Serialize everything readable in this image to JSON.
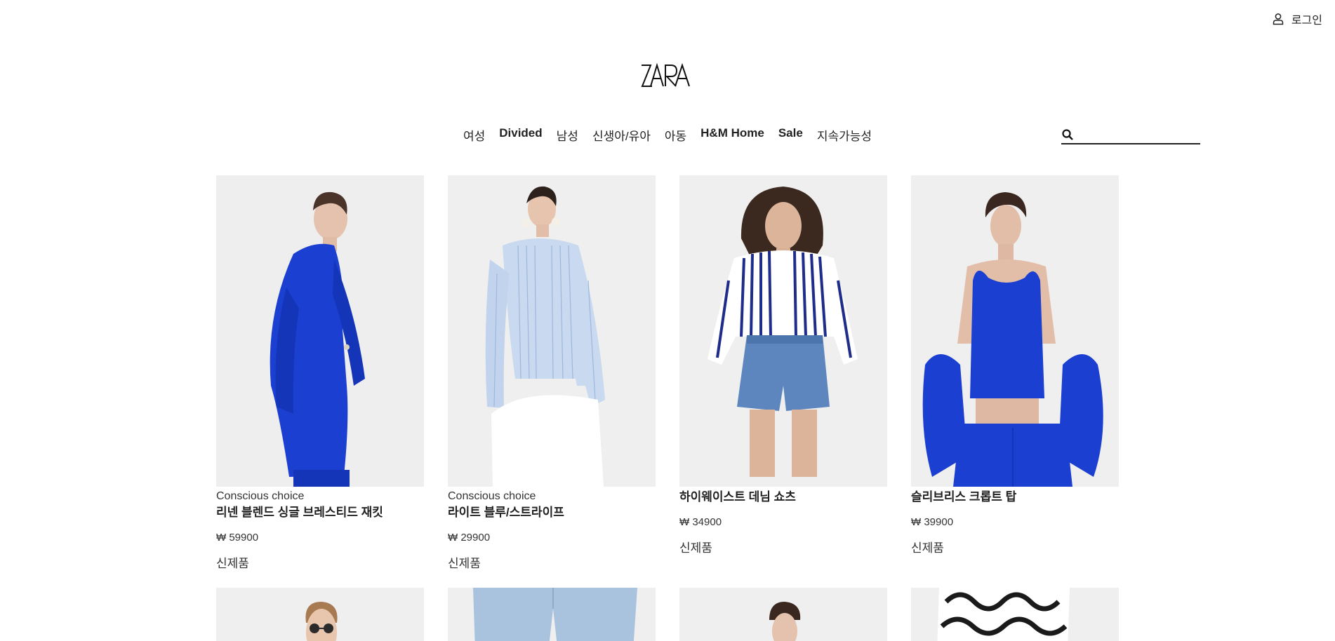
{
  "header": {
    "login_label": "로그인",
    "logo_text": "ZARA"
  },
  "nav": {
    "items": [
      {
        "label": "여성"
      },
      {
        "label": "Divided"
      },
      {
        "label": "남성"
      },
      {
        "label": "신생아/유아"
      },
      {
        "label": "아동"
      },
      {
        "label": "H&M Home"
      },
      {
        "label": "Sale"
      },
      {
        "label": "지속가능성"
      }
    ]
  },
  "search": {
    "placeholder": "",
    "value": ""
  },
  "products": [
    {
      "eyebrow": "Conscious choice",
      "title": "리넨 블렌드 싱글 브레스티드 재킷",
      "price": "₩ 59900",
      "badge": "신제품",
      "image": "model-blue-blazer"
    },
    {
      "eyebrow": "Conscious choice",
      "title": "라이트 블루/스트라이프",
      "price": "₩ 29900",
      "badge": "신제품",
      "image": "model-striped-shirt"
    },
    {
      "eyebrow": "",
      "title": "하이웨이스트 데님 쇼츠",
      "price": "₩ 34900",
      "badge": "신제품",
      "image": "model-denim-shorts"
    },
    {
      "eyebrow": "",
      "title": "슬리브리스 크롭트 탑",
      "price": "₩ 39900",
      "badge": "신제품",
      "image": "model-blue-crop-top"
    }
  ],
  "colors": {
    "accent_blue": "#1a3fd1",
    "photo_bg": "#efefef",
    "text": "#222222"
  }
}
